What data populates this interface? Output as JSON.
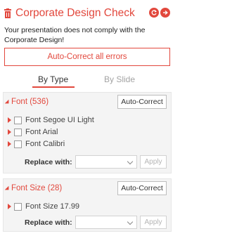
{
  "header": {
    "title": "Corporate Design Check",
    "icons": [
      "trash-icon",
      "refresh-icon",
      "forward-icon"
    ]
  },
  "message": "Your presentation does not comply with the Corporate Design!",
  "autocorrect_all_label": "Auto-Correct all errors",
  "tabs": [
    {
      "label": "By Type",
      "selected": true
    },
    {
      "label": "By Slide",
      "selected": false
    }
  ],
  "groups": [
    {
      "title": "Font (536)",
      "autocorrect_label": "Auto-Correct",
      "items": [
        "Font Segoe UI Light",
        "Font Arial",
        "Font Calibri"
      ],
      "replace_label": "Replace with:",
      "replace_value": "",
      "apply_label": "Apply"
    },
    {
      "title": "Font Size (28)",
      "autocorrect_label": "Auto-Correct",
      "items": [
        "Font Size 17.99"
      ],
      "replace_label": "Replace with:",
      "replace_value": "",
      "apply_label": "Apply"
    }
  ],
  "colors": {
    "accent": "#e2483d",
    "panel_bg": "#f4f4f4",
    "inactive_tab": "#a3a3a3"
  }
}
